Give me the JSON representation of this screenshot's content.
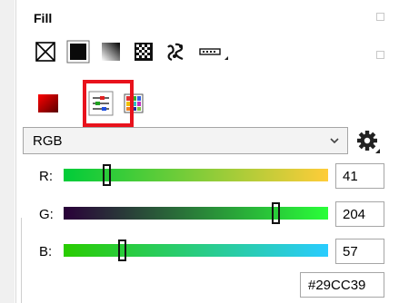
{
  "panel": {
    "title": "Fill"
  },
  "fill_types": [
    {
      "name": "no-fill-icon"
    },
    {
      "name": "uniform-fill-icon"
    },
    {
      "name": "fountain-fill-icon"
    },
    {
      "name": "pattern-fill-icon"
    },
    {
      "name": "texture-fill-icon"
    },
    {
      "name": "postscript-fill-icon"
    }
  ],
  "color_modes": [
    "color-viewers-icon",
    "color-sliders-icon",
    "color-palettes-icon"
  ],
  "color_model": {
    "selected": "RGB"
  },
  "channels": {
    "r": {
      "label": "R:",
      "value": "41",
      "fraction": 0.16
    },
    "g": {
      "label": "G:",
      "value": "204",
      "fraction": 0.8
    },
    "b": {
      "label": "B:",
      "value": "57",
      "fraction": 0.22
    }
  },
  "hex_value": "#29CC39",
  "colors": {
    "current": "#29CC39",
    "highlight": "#E8121C"
  }
}
